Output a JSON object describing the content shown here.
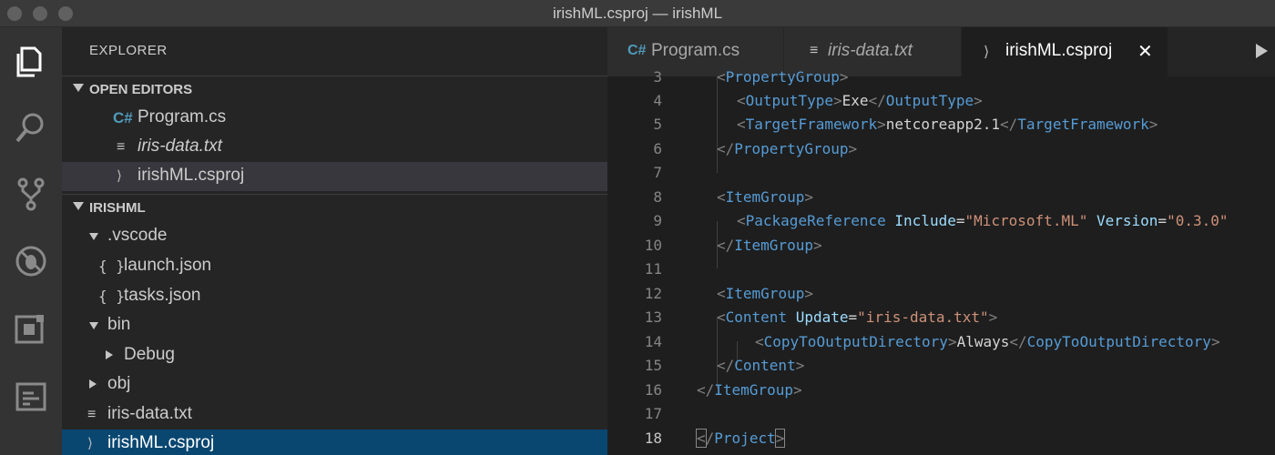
{
  "window": {
    "title": "irishML.csproj — irishML"
  },
  "activity_bar": {
    "icons": [
      "explorer-icon",
      "search-icon",
      "source-control-icon",
      "debug-icon",
      "extensions-icon",
      "panel-icon"
    ]
  },
  "sidebar": {
    "header": "EXPLORER",
    "open_editors_title": "OPEN EDITORS",
    "open_editors": [
      {
        "label": "Program.cs",
        "icon": "C#"
      },
      {
        "label": "iris-data.txt",
        "icon": "≡"
      },
      {
        "label": "irishML.csproj",
        "icon": "⟩"
      }
    ],
    "folder_title": "IRISHML",
    "tree": {
      "vscode": ".vscode",
      "launch": "launch.json",
      "tasks": "tasks.json",
      "json_icon": "{ }",
      "bin": "bin",
      "debug": "Debug",
      "obj": "obj",
      "iris": "iris-data.txt",
      "csproj": "irishML.csproj"
    }
  },
  "tabs": [
    {
      "label": "Program.cs",
      "icon": "C#"
    },
    {
      "label": "iris-data.txt",
      "icon": "≡"
    },
    {
      "label": "irishML.csproj",
      "icon": "⟩",
      "close": "✕"
    }
  ],
  "code": {
    "line_numbers": [
      "3",
      "4",
      "5",
      "6",
      "7",
      "8",
      "9",
      "10",
      "11",
      "12",
      "13",
      "14",
      "15",
      "16",
      "17",
      "18"
    ],
    "l3": "PropertyGroup",
    "l4_tag": "OutputType",
    "l4_val": "Exe",
    "l5_tag": "TargetFramework",
    "l5_val": "netcoreapp2.1",
    "l6_tag": "PropertyGroup",
    "l8_tag": "ItemGroup",
    "l9_tag": "PackageReference",
    "l9_a1": "Include",
    "l9_v1": "\"Microsoft.ML\"",
    "l9_a2": "Version",
    "l9_v2": "\"0.3.0\"",
    "l10_tag": "ItemGroup",
    "l12_tag": "ItemGroup",
    "l13_tag": "Content",
    "l13_a1": "Update",
    "l13_v1": "\"iris-data.txt\"",
    "l14_tag": "CopyToOutputDirectory",
    "l14_val": "Always",
    "l15_tag": "Content",
    "l16_tag": "ItemGroup",
    "l18_tag": "Project"
  },
  "colors": {
    "accent_selected": "#094771",
    "tag": "#569cd6",
    "attr": "#9cdcfe",
    "string": "#ce9178"
  }
}
